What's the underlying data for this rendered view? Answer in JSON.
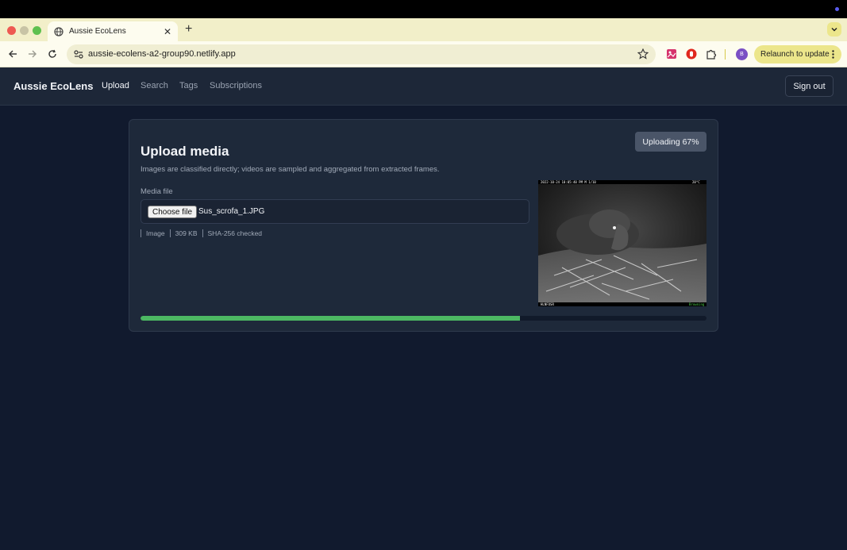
{
  "browser": {
    "tab_title": "Aussie EcoLens",
    "url": "aussie-ecolens-a2-group90.netlify.app",
    "relaunch_label": "Relaunch to update",
    "profile_initial": "B",
    "accent_color": "#ece68b"
  },
  "app": {
    "brand": "Aussie EcoLens",
    "nav": [
      {
        "label": "Upload",
        "active": true
      },
      {
        "label": "Search",
        "active": false
      },
      {
        "label": "Tags",
        "active": false
      },
      {
        "label": "Subscriptions",
        "active": false
      }
    ],
    "signout_label": "Sign out"
  },
  "upload": {
    "title": "Upload media",
    "description": "Images are classified directly; videos are sampled and aggregated from extracted frames.",
    "status": "Uploading 67%",
    "progress_percent": 67,
    "progress_color": "#4cb862",
    "field_label": "Media file",
    "choose_label": "Choose file",
    "file_name": "Sus_scrofa_1.JPG",
    "meta": {
      "type": "Image",
      "size": "309 KB",
      "hash": "SHA-256 checked"
    },
    "preview": {
      "header_text": "2022-10-24 10:05:40 PM  M 1/10",
      "temp_text": "20°C",
      "footer_left": "HLNFOSR",
      "footer_right": "Browning"
    }
  }
}
